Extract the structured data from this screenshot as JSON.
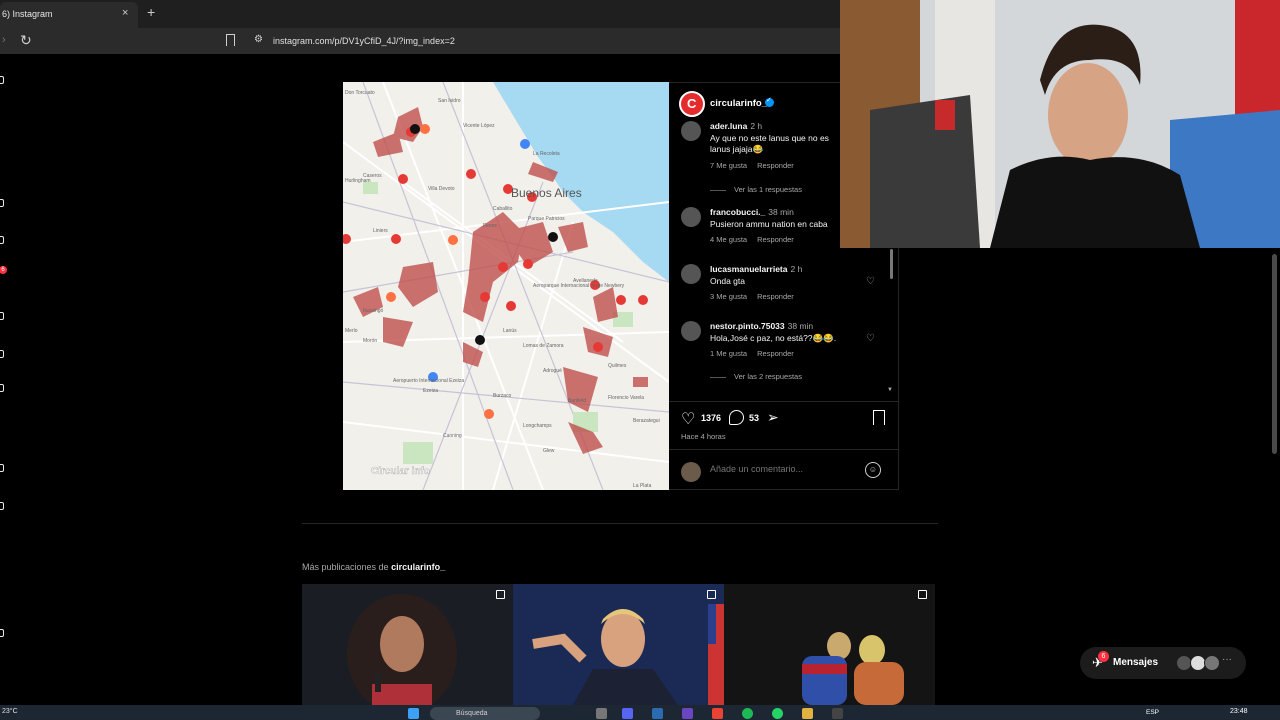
{
  "browser": {
    "tab_title": "6) Instagram",
    "tab_close": "×",
    "new_tab": "+",
    "url": "instagram.com/p/DV1yCfiD_4J/?img_index=2"
  },
  "left_rail": {
    "badge": "6"
  },
  "map": {
    "city_label": "Buenos Aires",
    "watermark": "Circular info",
    "place_labels": [
      "Don Torcuato",
      "San Isidro",
      "Vicente López",
      "Villa Devoto",
      "Caseros",
      "Liniers",
      "Flores",
      "Caballito",
      "Parque Patricios",
      "La Recoleta",
      "Aeroparque Internacional Jorge Newbery",
      "Lanús",
      "Lomas de Zamora",
      "Banfield",
      "Avellaneda",
      "Quilmes",
      "Florencio Varela",
      "Berazategui",
      "Adrogué",
      "Burzaco",
      "Longchamps",
      "Ezeiza",
      "Aeropuerto Internacional Ezeiza",
      "Canning",
      "Glew",
      "La Plata",
      "Hurlingham",
      "Morón",
      "Ituzaingó",
      "Merlo"
    ]
  },
  "post": {
    "author": "circularinfo_",
    "comments": [
      {
        "user": "ader.luna",
        "time": "2 h",
        "text_lines": [
          "Ay que no este lanus que no es",
          "lanus jajaja😂"
        ],
        "likes": "7 Me gusta",
        "reply": "Responder",
        "replies": "Ver las 1 respuestas"
      },
      {
        "user": "francobucci._",
        "time": "38 min",
        "text_lines": [
          "Pusieron ammu nation en caba"
        ],
        "likes": "4 Me gusta",
        "reply": "Responder"
      },
      {
        "user": "lucasmanuelarrieta",
        "time": "2 h",
        "text_lines": [
          "Onda gta"
        ],
        "likes": "3 Me gusta",
        "reply": "Responder"
      },
      {
        "user": "nestor.pinto.75033",
        "time": "38 min",
        "text_lines": [
          "Hola,José c paz, no está??😂😂."
        ],
        "likes": "1 Me gusta",
        "reply": "Responder",
        "replies": "Ver las 2 respuestas"
      }
    ],
    "like_count": "1376",
    "comment_count": "53",
    "posted": "Hace 4 horas",
    "add_comment_placeholder": "Añade un comentario..."
  },
  "more_posts": {
    "prefix": "Más publicaciones de",
    "account": "circularinfo_"
  },
  "messages": {
    "label": "Mensajes",
    "badge": "6",
    "more": "···"
  },
  "taskbar": {
    "weather": "23°C",
    "search_label": "Búsqueda",
    "lang": "ESP",
    "clock": "23:48"
  },
  "colors": {
    "accent_red": "#e52b2b",
    "verified_blue": "#0095f6",
    "map_water": "#a6d9f2",
    "map_zone": "#c0504d"
  }
}
